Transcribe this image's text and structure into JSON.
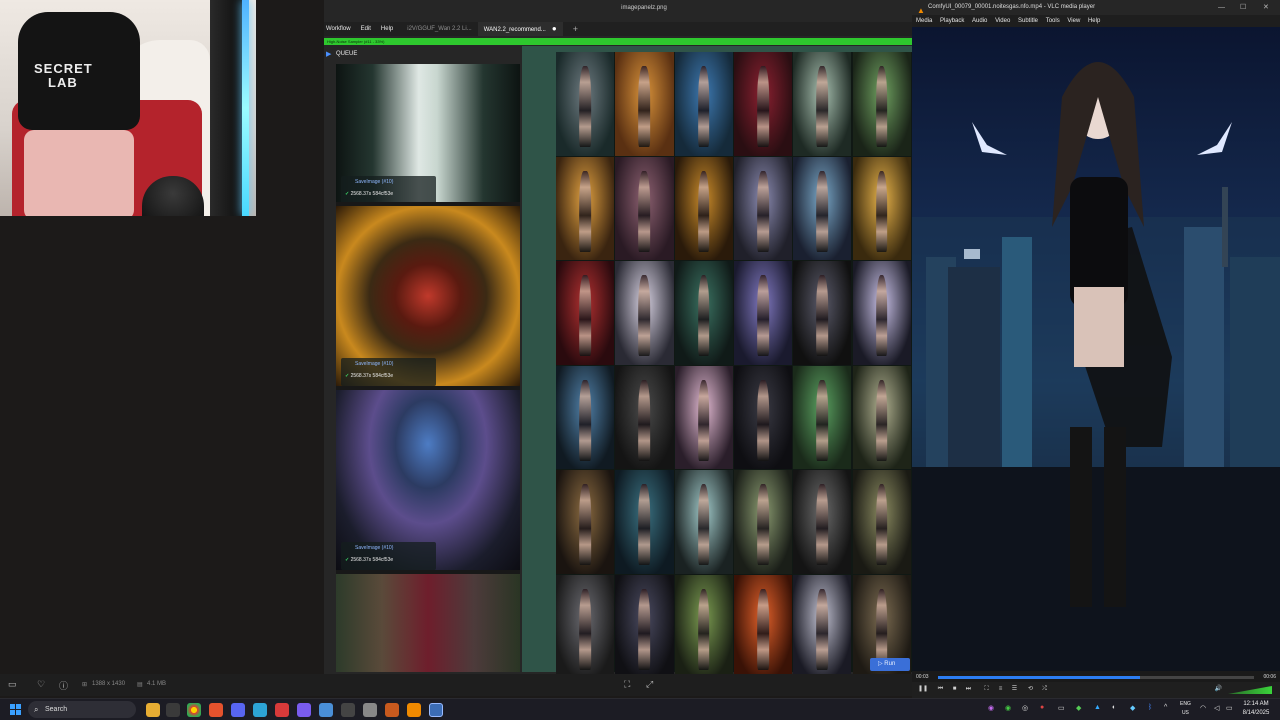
{
  "viewer": {
    "title": "imagepanelz.png",
    "menu": [
      "Workflow",
      "Edit",
      "Help"
    ],
    "tabs": [
      "i2V/GGUF_Wan 2.2 Li...",
      "WAN2.2_recommend..."
    ],
    "progress_text": "High-Noise Sampler (#11 - 33%)",
    "progress_value": 1.0,
    "queue_label": "QUEUE",
    "canvas_label": "Save Image",
    "run_label": "Run",
    "queue_items": [
      {
        "node": "SaveImage (#10)",
        "time": "2568.37s 584cf53e"
      },
      {
        "node": "SaveImage (#10)",
        "time": "2568.37s 584cf53e"
      },
      {
        "node": "SaveImage (#10)",
        "time": "2568.37s 584cf53e"
      }
    ]
  },
  "status": {
    "dimensions": "1388 x 1430",
    "size": "4.1 MB"
  },
  "vlc": {
    "title": "ComfyUI_00079_00001.noitesgas.nfo.mp4 - VLC media player",
    "menu": [
      "Media",
      "Playback",
      "Audio",
      "Video",
      "Subtitle",
      "Tools",
      "View",
      "Help"
    ],
    "time_elapsed": "00:03",
    "time_total": "00:06",
    "played_fraction": 0.64
  },
  "taskbar": {
    "search_placeholder": "Search",
    "lang_top": "ENG",
    "lang_bottom": "US",
    "time": "12:14 AM",
    "date": "8/14/2025"
  },
  "webcam": {
    "chair_brand_top": "SECRET",
    "chair_brand_bottom": "LAB"
  },
  "colors": {
    "progress": "#2ec82e",
    "canvas": "#2f5448",
    "run_button": "#3a6fd8",
    "vlc_seek": "#2c7df0"
  }
}
